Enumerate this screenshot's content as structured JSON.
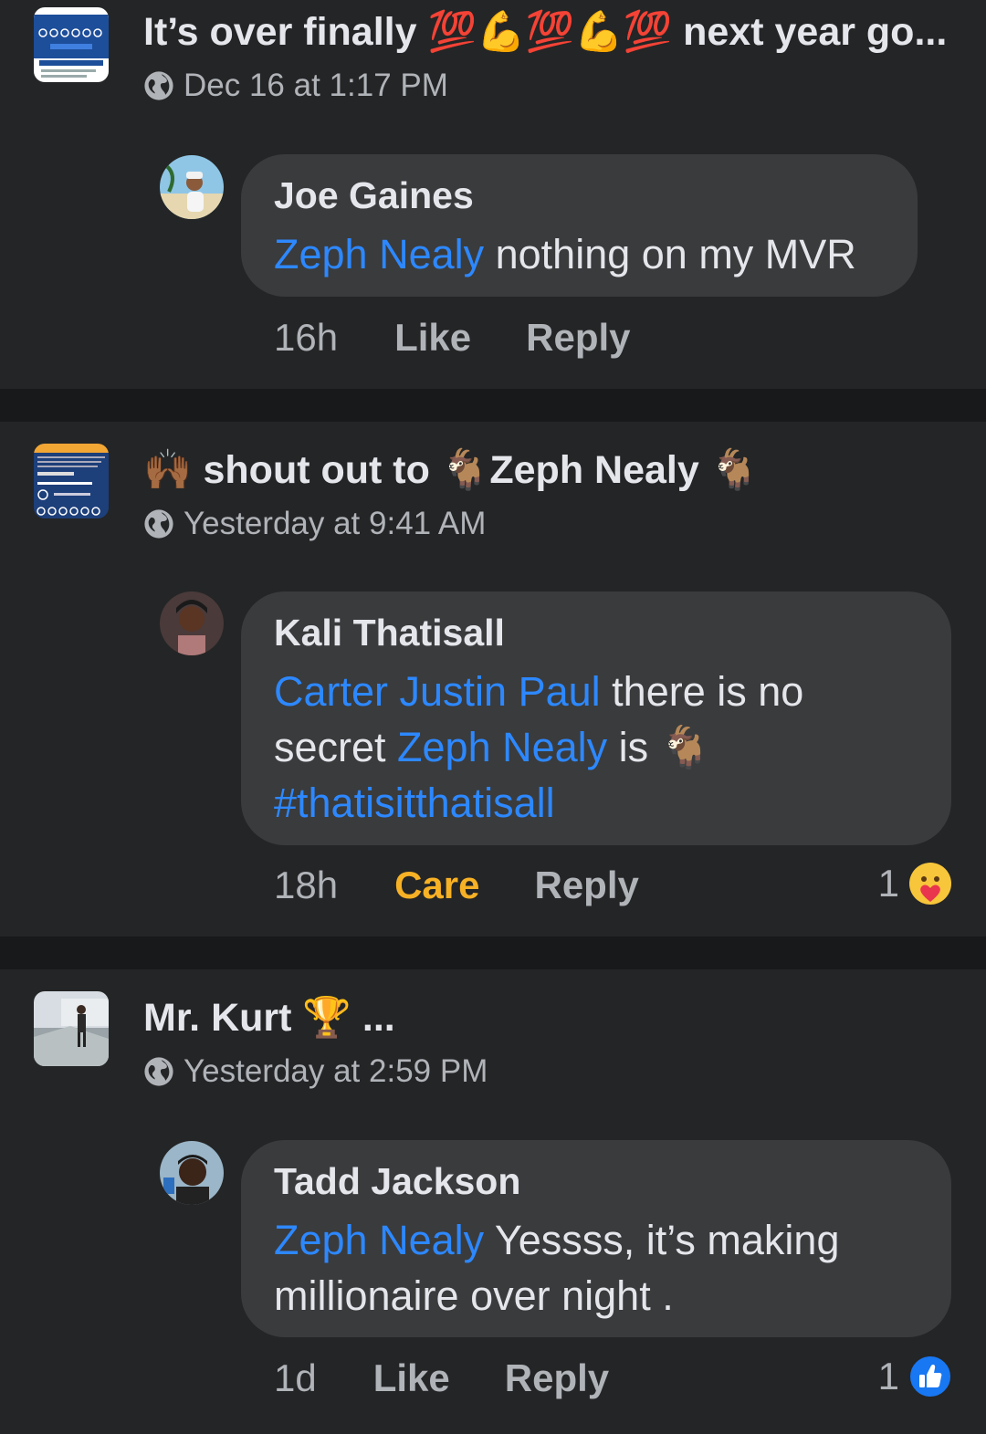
{
  "posts": [
    {
      "title_text": "It’s over finally",
      "title_emojis": "💯💪💯💪💯",
      "title_tail": "next year go...",
      "timestamp": "Dec 16 at 1:17 PM",
      "comment": {
        "author": "Joe Gaines",
        "mention": "Zeph Nealy",
        "text": " nothing on my MVR",
        "time": "16h",
        "like_label": "Like",
        "reply_label": "Reply"
      }
    },
    {
      "title_emoji_start": "🙌🏾",
      "title_text": "shout out to",
      "title_emoji_mid": "🐐",
      "title_name": "Zeph Nealy",
      "title_emoji_end": "🐐",
      "timestamp": "Yesterday at 9:41 AM",
      "comment": {
        "author": "Kali Thatisall",
        "mention1": "Carter Justin Paul",
        "text1": " there is no secret ",
        "mention2": "Zeph Nealy",
        "text2": " is 🐐",
        "hashtag": "#thatisitthatisall",
        "time": "18h",
        "care_label": "Care",
        "reply_label": "Reply",
        "reaction_count": "1",
        "reaction_icon": "care-emoji-icon"
      }
    },
    {
      "title_text": "Mr. Kurt",
      "title_emoji": "🏆",
      "title_tail": "...",
      "timestamp": "Yesterday at 2:59 PM",
      "comment": {
        "author": "Tadd Jackson",
        "mention": "Zeph Nealy",
        "text": " Yessss, it’s making millionaire over night .",
        "time": "1d",
        "like_label": "Like",
        "reply_label": "Reply",
        "reaction_count": "1",
        "reaction_icon": "like-thumb-icon"
      }
    }
  ],
  "colors": {
    "background": "#242526",
    "divider": "#18191a",
    "bubble": "#3a3b3c",
    "mention": "#2d88ff",
    "care": "#f7b125",
    "like_blue": "#1877f2"
  }
}
